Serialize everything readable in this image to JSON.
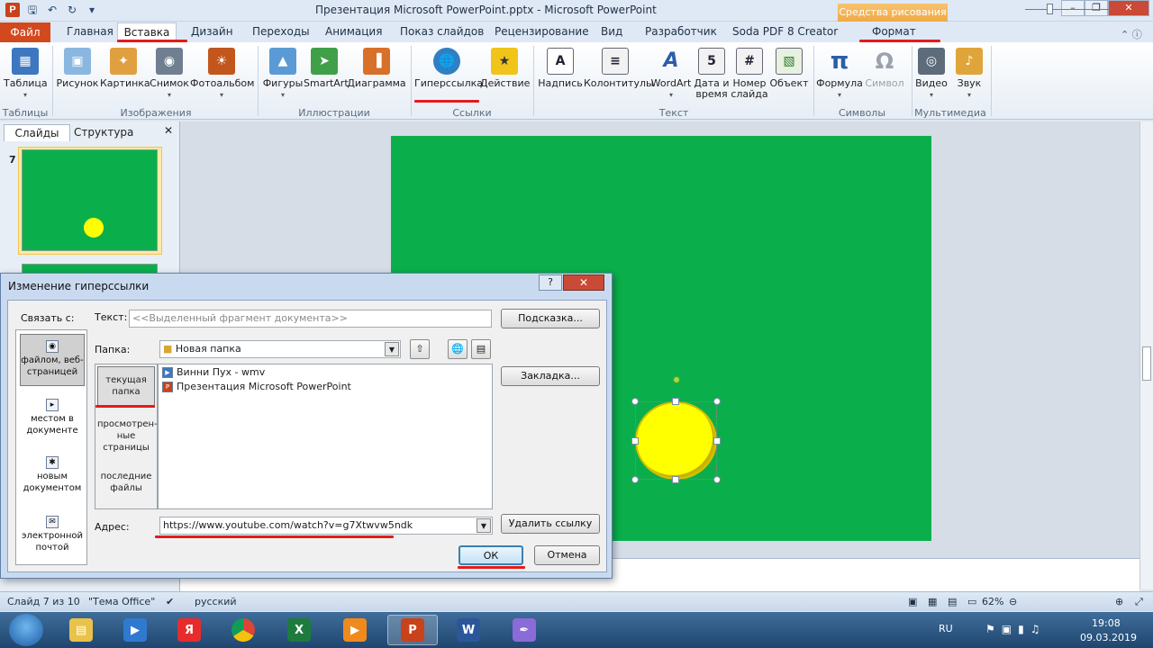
{
  "window": {
    "title": "Презентация Microsoft PowerPoint.pptx - Microsoft PowerPoint",
    "app_letter": "P",
    "contextual_group": "Средства рисования"
  },
  "tabs": {
    "file": "Файл",
    "home": "Главная",
    "insert": "Вставка",
    "design": "Дизайн",
    "transitions": "Переходы",
    "animation": "Анимация",
    "slideshow": "Показ слайдов",
    "review": "Рецензирование",
    "view": "Вид",
    "developer": "Разработчик",
    "soda": "Soda PDF 8 Creator",
    "format": "Формат"
  },
  "ribbon": {
    "table": "Таблица",
    "picture": "Рисунок",
    "clipart": "Картинка",
    "screenshot": "Снимок",
    "photoalbum": "Фотоальбом",
    "shapes": "Фигуры",
    "smartart": "SmartArt",
    "chart": "Диаграмма",
    "hyperlink": "Гиперссылка",
    "action": "Действие",
    "textbox": "Надпись",
    "headerfooter": "Колонтитулы",
    "wordart": "WordArt",
    "datetime_1": "Дата и",
    "datetime_2": "время",
    "slidenum_1": "Номер",
    "slidenum_2": "слайда",
    "object": "Объект",
    "formula": "Формула",
    "symbol": "Символ",
    "video": "Видео",
    "sound": "Звук",
    "groups": {
      "tables": "Таблицы",
      "images": "Изображения",
      "illustrations": "Иллюстрации",
      "links": "Ссылки",
      "text": "Текст",
      "symbols": "Символы",
      "media": "Мультимедиа"
    }
  },
  "left_panel": {
    "tab_slides": "Слайды",
    "tab_outline": "Структура",
    "slide_number": "7"
  },
  "status": {
    "slide": "Слайд 7 из 10",
    "theme": "\"Тема Office\"",
    "language": "русский",
    "zoom": "62%"
  },
  "taskbar": {
    "lang": "RU",
    "time": "19:08",
    "date": "09.03.2019"
  },
  "dialog": {
    "title": "Изменение гиперссылки",
    "help": "?",
    "link_to": "Связать с:",
    "link_items": [
      "файлом, веб-страницей",
      "местом в документе",
      "новым документом",
      "электронной почтой"
    ],
    "text_label": "Текст:",
    "text_value": "<<Выделенный фрагмент документа>>",
    "tooltip_btn": "Подсказка...",
    "folder_label": "Папка:",
    "folder_value": "Новая папка",
    "bookmark_btn": "Закладка...",
    "views": [
      "текущая папка",
      "просмотрен-ные страницы",
      "последние файлы"
    ],
    "files": [
      "Винни Пух - wmv",
      "Презентация Microsoft PowerPoint"
    ],
    "address_label": "Адрес:",
    "address_value": "https://www.youtube.com/watch?v=g7Xtwvw5ndk",
    "remove_btn": "Удалить ссылку",
    "ok_btn": "ОК",
    "cancel_btn": "Отмена"
  },
  "colors": {
    "slide_bg": "#0aaf4b",
    "shape_fill": "#ffff00",
    "highlight": "#e31b1b",
    "file_tab": "#d2491e"
  }
}
